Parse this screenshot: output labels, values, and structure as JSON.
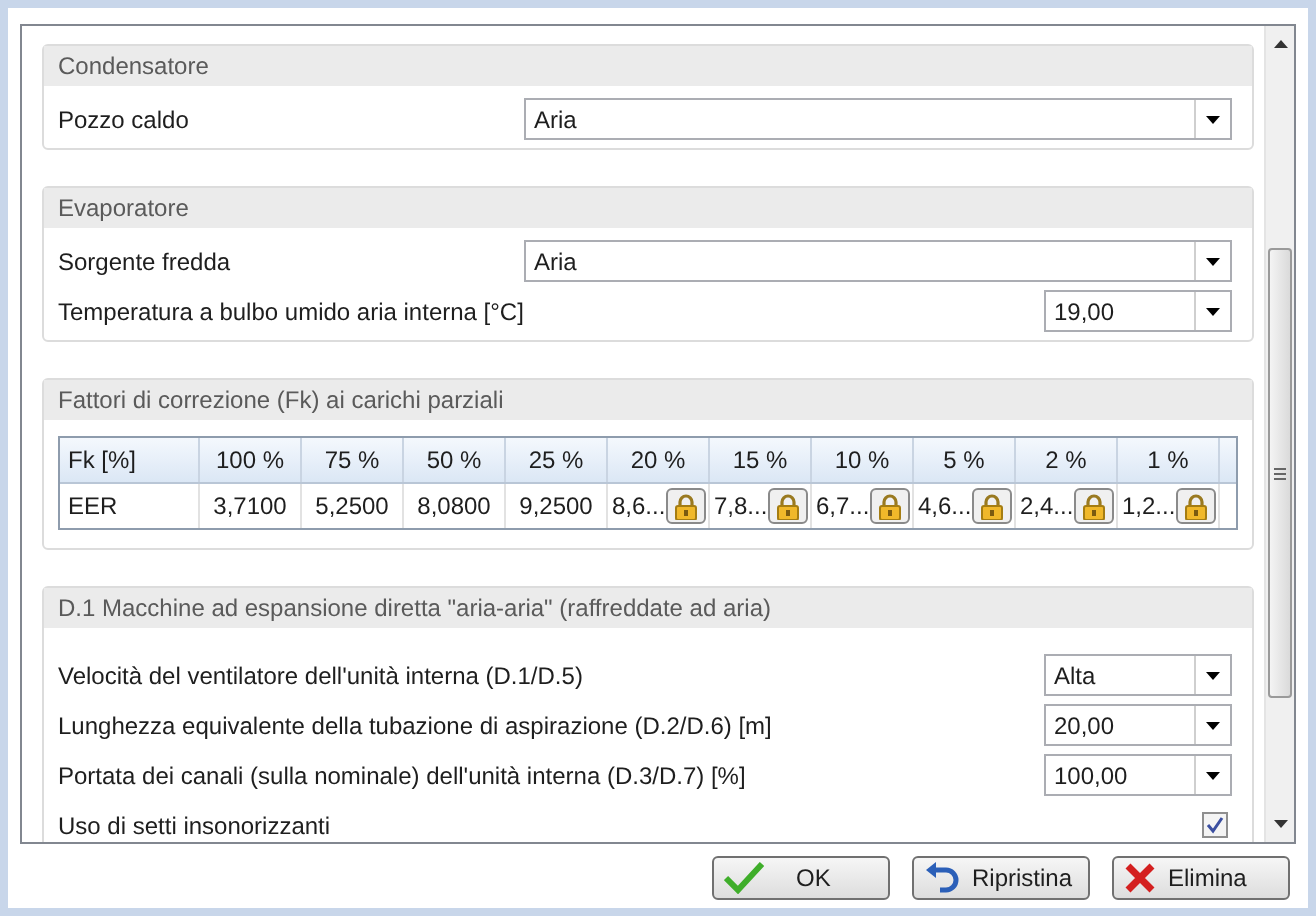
{
  "sections": [
    {
      "title": "Condensatore",
      "rows": [
        {
          "kind": "wide-dropdown",
          "label": "Pozzo caldo",
          "value": "Aria"
        }
      ]
    },
    {
      "title": "Evaporatore",
      "rows": [
        {
          "kind": "wide-dropdown",
          "label": "Sorgente fredda",
          "value": "Aria"
        },
        {
          "kind": "dropdown",
          "label": "Temperatura a bulbo umido aria interna [°C]",
          "value": "19,00"
        }
      ]
    },
    {
      "title": "Fattori di correzione (Fk) ai carichi parziali",
      "table": {
        "columns": [
          "Fk [%]",
          "100 %",
          "75 %",
          "50 %",
          "25 %",
          "20 %",
          "15 %",
          "10 %",
          "5 %",
          "2 %",
          "1 %"
        ],
        "rows": [
          {
            "cells": [
              {
                "value": "EER"
              },
              {
                "value": "3,7100"
              },
              {
                "value": "5,2500"
              },
              {
                "value": "8,0800"
              },
              {
                "value": "9,2500"
              },
              {
                "value": "8,6...",
                "locked": true
              },
              {
                "value": "7,8...",
                "locked": true
              },
              {
                "value": "6,7...",
                "locked": true
              },
              {
                "value": "4,6...",
                "locked": true
              },
              {
                "value": "2,4...",
                "locked": true
              },
              {
                "value": "1,2...",
                "locked": true
              }
            ]
          }
        ]
      }
    },
    {
      "title": "D.1 Macchine ad espansione diretta \"aria-aria\" (raffreddate ad aria)",
      "rows": [
        {
          "kind": "dropdown",
          "label": "Velocità del ventilatore dell'unità interna (D.1/D.5)",
          "value": "Alta"
        },
        {
          "kind": "dropdown",
          "label": "Lunghezza equivalente della tubazione di aspirazione (D.2/D.6) [m]",
          "value": "20,00"
        },
        {
          "kind": "dropdown",
          "label": "Portata dei canali (sulla nominale) dell'unità interna (D.3/D.7) [%]",
          "value": "100,00"
        },
        {
          "kind": "checkbox",
          "label": "Uso di setti insonorizzanti",
          "checked": true
        }
      ]
    }
  ],
  "buttons": [
    {
      "kind": "ok",
      "label": "OK"
    },
    {
      "kind": "reset",
      "label": "Ripristina"
    },
    {
      "kind": "delete",
      "label": "Elimina"
    }
  ]
}
